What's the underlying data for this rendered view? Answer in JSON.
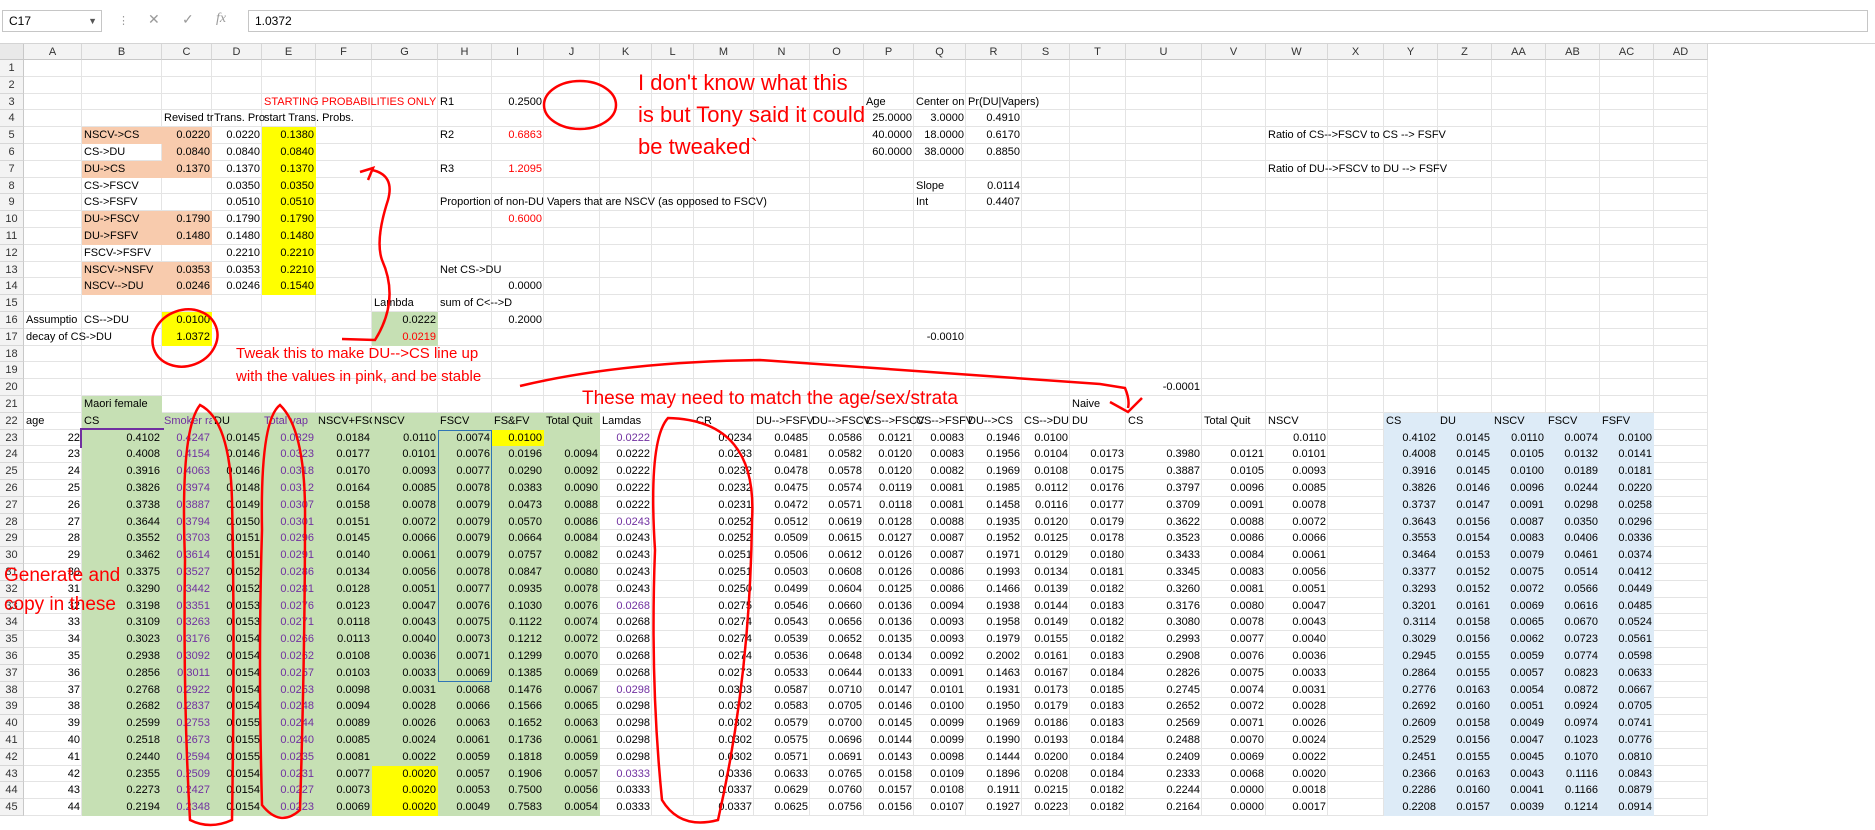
{
  "formula_bar": {
    "name_box": "C17",
    "formula": "1.0372",
    "cancel_icon": "✕",
    "enter_icon": "✓",
    "fx_icon": "fx"
  },
  "columns": [
    "A",
    "B",
    "C",
    "D",
    "E",
    "F",
    "G",
    "H",
    "I",
    "J",
    "K",
    "L",
    "M",
    "N",
    "O",
    "P",
    "Q",
    "R",
    "S",
    "T",
    "U",
    "V",
    "W",
    "X",
    "Y",
    "Z",
    "AA",
    "AB",
    "AC",
    "AD"
  ],
  "rows": [
    "1",
    "2",
    "3",
    "4",
    "5",
    "6",
    "7",
    "8",
    "9",
    "10",
    "11",
    "12",
    "13",
    "14",
    "15",
    "16",
    "17",
    "18",
    "19",
    "20",
    "21",
    "22",
    "23",
    "24",
    "25",
    "26",
    "27",
    "28",
    "29",
    "30",
    "31",
    "32",
    "33",
    "34",
    "35",
    "36",
    "37",
    "38",
    "39",
    "40",
    "41",
    "42",
    "43",
    "44",
    "45"
  ],
  "cells": {
    "E3": "STARTING PROBABILITIES ONLY",
    "H3": "R1",
    "I3": "0.2500",
    "P3": "Age",
    "Q3": "Center on",
    "R3": "Pr(DU|Vapers)",
    "C4": "Revised tr",
    "D4": "Trans. Pro",
    "E4": "start Trans. Probs.",
    "P4": "25.0000",
    "Q4": "3.0000",
    "R4": "0.4910",
    "B5": "NSCV->CS",
    "C5": "0.0220",
    "D5": "0.0220",
    "E5": "0.1380",
    "H5": "R2",
    "I5": "0.6863",
    "P5": "40.0000",
    "Q5": "18.0000",
    "R5": "0.6170",
    "W5": "Ratio of CS-->FSCV to CS --> FSFV",
    "B6": "CS->DU",
    "C6": "0.0840",
    "D6": "0.0840",
    "E6": "0.0840",
    "P6": "60.0000",
    "Q6": "38.0000",
    "R6": "0.8850",
    "B7": "DU->CS",
    "C7": "0.1370",
    "D7": "0.1370",
    "E7": "0.1370",
    "H7": "R3",
    "I7": "1.2095",
    "W7": "Ratio of DU-->FSCV to DU --> FSFV",
    "B8": "CS->FSCV",
    "D8": "0.0350",
    "E8": "0.0350",
    "Q8": "Slope",
    "R8": "0.0114",
    "B9": "CS->FSFV",
    "D9": "0.0510",
    "E9": "0.0510",
    "H9": "Proportion of non-DU Vapers that are NSCV (as opposed to FSCV)",
    "Q9": "Int",
    "R9": "0.4407",
    "B10": "DU->FSCV",
    "C10": "0.1790",
    "D10": "0.1790",
    "E10": "0.1790",
    "I10": "0.6000",
    "B11": "DU->FSFV",
    "C11": "0.1480",
    "D11": "0.1480",
    "E11": "0.1480",
    "B12": "FSCV->FSFV",
    "D12": "0.2210",
    "E12": "0.2210",
    "B13": "NSCV->NSFV",
    "C13": "0.0353",
    "D13": "0.0353",
    "E13": "0.2210",
    "H13": "Net CS->DU",
    "B14": "NSCV-->DU",
    "C14": "0.0246",
    "D14": "0.0246",
    "E14": "0.1540",
    "I14": "0.0000",
    "G15": "Lambda",
    "H15": "sum of C<-->D",
    "A16": "Assumptio",
    "B16": "CS-->DU",
    "C16": "0.0100",
    "G16": "0.0222",
    "I16": "0.2000",
    "A17": "decay of CS->DU",
    "C17": "1.0372",
    "G17": "0.0219",
    "Q17": "-0.0010",
    "U20": "-0.0001",
    "B21": "Maori female",
    "T21": "Naive",
    "A22": "age",
    "B22": "CS",
    "C22": "Smoker ra",
    "D22": "DU",
    "E22": "Total vap",
    "F22": "NSCV+FSCV",
    "G22": "NSCV",
    "H22": "FSCV",
    "I22": "FS&FV",
    "J22": "Total Quit",
    "K22": "Lamdas",
    "M22": "CR",
    "N22": "DU-->FSFV",
    "O22": "DU-->FSCV",
    "P22": "CS-->FSCV",
    "Q22": "CS-->FSFV",
    "R22": "DU-->CS",
    "S22": "CS-->DU",
    "T22": "DU",
    "U22": "CS",
    "V22": "Total Quit",
    "W22": "NSCV",
    "Y22": "CS",
    "Z22": "DU",
    "AA22": "NSCV",
    "AB22": "FSCV",
    "AC22": "FSFV"
  },
  "table": [
    [
      "22",
      "0.4102",
      "0.4247",
      "0.0145",
      "0.0329",
      "0.0184",
      "0.0110",
      "0.0074",
      "0.0100",
      "",
      "0.0222",
      "0.0234",
      "0.0485",
      "0.0586",
      "0.0121",
      "0.0083",
      "0.1946",
      "0.0100",
      "",
      "",
      "",
      "0.0110",
      "0.4102",
      "0.0145",
      "0.0110",
      "0.0074",
      "0.0100"
    ],
    [
      "23",
      "0.4008",
      "0.4154",
      "0.0146",
      "0.0323",
      "0.0177",
      "0.0101",
      "0.0076",
      "0.0196",
      "0.0094",
      "0.0222",
      "0.0233",
      "0.0481",
      "0.0582",
      "0.0120",
      "0.0083",
      "0.1956",
      "0.0104",
      "0.0173",
      "0.3980",
      "0.0121",
      "0.0101",
      "0.4008",
      "0.0145",
      "0.0105",
      "0.0132",
      "0.0141"
    ],
    [
      "24",
      "0.3916",
      "0.4063",
      "0.0146",
      "0.0318",
      "0.0170",
      "0.0093",
      "0.0077",
      "0.0290",
      "0.0092",
      "0.0222",
      "0.0232",
      "0.0478",
      "0.0578",
      "0.0120",
      "0.0082",
      "0.1969",
      "0.0108",
      "0.0175",
      "0.3887",
      "0.0105",
      "0.0093",
      "0.3916",
      "0.0145",
      "0.0100",
      "0.0189",
      "0.0181"
    ],
    [
      "25",
      "0.3826",
      "0.3974",
      "0.0148",
      "0.0312",
      "0.0164",
      "0.0085",
      "0.0078",
      "0.0383",
      "0.0090",
      "0.0222",
      "0.0232",
      "0.0475",
      "0.0574",
      "0.0119",
      "0.0081",
      "0.1985",
      "0.0112",
      "0.0176",
      "0.3797",
      "0.0096",
      "0.0085",
      "0.3826",
      "0.0146",
      "0.0096",
      "0.0244",
      "0.0220"
    ],
    [
      "26",
      "0.3738",
      "0.3887",
      "0.0149",
      "0.0307",
      "0.0158",
      "0.0078",
      "0.0079",
      "0.0473",
      "0.0088",
      "0.0222",
      "0.0231",
      "0.0472",
      "0.0571",
      "0.0118",
      "0.0081",
      "0.1458",
      "0.0116",
      "0.0177",
      "0.3709",
      "0.0091",
      "0.0078",
      "0.3737",
      "0.0147",
      "0.0091",
      "0.0298",
      "0.0258"
    ],
    [
      "27",
      "0.3644",
      "0.3794",
      "0.0150",
      "0.0301",
      "0.0151",
      "0.0072",
      "0.0079",
      "0.0570",
      "0.0086",
      "0.0243",
      "0.0252",
      "0.0512",
      "0.0619",
      "0.0128",
      "0.0088",
      "0.1935",
      "0.0120",
      "0.0179",
      "0.3622",
      "0.0088",
      "0.0072",
      "0.3643",
      "0.0156",
      "0.0087",
      "0.0350",
      "0.0296"
    ],
    [
      "28",
      "0.3552",
      "0.3703",
      "0.0151",
      "0.0296",
      "0.0145",
      "0.0066",
      "0.0079",
      "0.0664",
      "0.0084",
      "0.0243",
      "0.0252",
      "0.0509",
      "0.0615",
      "0.0127",
      "0.0087",
      "0.1952",
      "0.0125",
      "0.0178",
      "0.3523",
      "0.0086",
      "0.0066",
      "0.3553",
      "0.0154",
      "0.0083",
      "0.0406",
      "0.0336"
    ],
    [
      "29",
      "0.3462",
      "0.3614",
      "0.0151",
      "0.0291",
      "0.0140",
      "0.0061",
      "0.0079",
      "0.0757",
      "0.0082",
      "0.0243",
      "0.0251",
      "0.0506",
      "0.0612",
      "0.0126",
      "0.0087",
      "0.1971",
      "0.0129",
      "0.0180",
      "0.3433",
      "0.0084",
      "0.0061",
      "0.3464",
      "0.0153",
      "0.0079",
      "0.0461",
      "0.0374"
    ],
    [
      "30",
      "0.3375",
      "0.3527",
      "0.0152",
      "0.0286",
      "0.0134",
      "0.0056",
      "0.0078",
      "0.0847",
      "0.0080",
      "0.0243",
      "0.0251",
      "0.0503",
      "0.0608",
      "0.0126",
      "0.0086",
      "0.1993",
      "0.0134",
      "0.0181",
      "0.3345",
      "0.0083",
      "0.0056",
      "0.3377",
      "0.0152",
      "0.0075",
      "0.0514",
      "0.0412"
    ],
    [
      "31",
      "0.3290",
      "0.3442",
      "0.0152",
      "0.0281",
      "0.0128",
      "0.0051",
      "0.0077",
      "0.0935",
      "0.0078",
      "0.0243",
      "0.0250",
      "0.0499",
      "0.0604",
      "0.0125",
      "0.0086",
      "0.1466",
      "0.0139",
      "0.0182",
      "0.3260",
      "0.0081",
      "0.0051",
      "0.3293",
      "0.0152",
      "0.0072",
      "0.0566",
      "0.0449"
    ],
    [
      "32",
      "0.3198",
      "0.3351",
      "0.0153",
      "0.0276",
      "0.0123",
      "0.0047",
      "0.0076",
      "0.1030",
      "0.0076",
      "0.0268",
      "0.0275",
      "0.0546",
      "0.0660",
      "0.0136",
      "0.0094",
      "0.1938",
      "0.0144",
      "0.0183",
      "0.3176",
      "0.0080",
      "0.0047",
      "0.3201",
      "0.0161",
      "0.0069",
      "0.0616",
      "0.0485"
    ],
    [
      "33",
      "0.3109",
      "0.3263",
      "0.0153",
      "0.0271",
      "0.0118",
      "0.0043",
      "0.0075",
      "0.1122",
      "0.0074",
      "0.0268",
      "0.0274",
      "0.0543",
      "0.0656",
      "0.0136",
      "0.0093",
      "0.1958",
      "0.0149",
      "0.0182",
      "0.3080",
      "0.0078",
      "0.0043",
      "0.3114",
      "0.0158",
      "0.0065",
      "0.0670",
      "0.0524"
    ],
    [
      "34",
      "0.3023",
      "0.3176",
      "0.0154",
      "0.0266",
      "0.0113",
      "0.0040",
      "0.0073",
      "0.1212",
      "0.0072",
      "0.0268",
      "0.0274",
      "0.0539",
      "0.0652",
      "0.0135",
      "0.0093",
      "0.1979",
      "0.0155",
      "0.0182",
      "0.2993",
      "0.0077",
      "0.0040",
      "0.3029",
      "0.0156",
      "0.0062",
      "0.0723",
      "0.0561"
    ],
    [
      "35",
      "0.2938",
      "0.3092",
      "0.0154",
      "0.0262",
      "0.0108",
      "0.0036",
      "0.0071",
      "0.1299",
      "0.0070",
      "0.0268",
      "0.0274",
      "0.0536",
      "0.0648",
      "0.0134",
      "0.0092",
      "0.2002",
      "0.0161",
      "0.0183",
      "0.2908",
      "0.0076",
      "0.0036",
      "0.2945",
      "0.0155",
      "0.0059",
      "0.0774",
      "0.0598"
    ],
    [
      "36",
      "0.2856",
      "0.3011",
      "0.0154",
      "0.0257",
      "0.0103",
      "0.0033",
      "0.0069",
      "0.1385",
      "0.0069",
      "0.0268",
      "0.0273",
      "0.0533",
      "0.0644",
      "0.0133",
      "0.0091",
      "0.1463",
      "0.0167",
      "0.0184",
      "0.2826",
      "0.0075",
      "0.0033",
      "0.2864",
      "0.0155",
      "0.0057",
      "0.0823",
      "0.0633"
    ],
    [
      "37",
      "0.2768",
      "0.2922",
      "0.0154",
      "0.0253",
      "0.0098",
      "0.0031",
      "0.0068",
      "0.1476",
      "0.0067",
      "0.0298",
      "0.0303",
      "0.0587",
      "0.0710",
      "0.0147",
      "0.0101",
      "0.1931",
      "0.0173",
      "0.0185",
      "0.2745",
      "0.0074",
      "0.0031",
      "0.2776",
      "0.0163",
      "0.0054",
      "0.0872",
      "0.0667"
    ],
    [
      "38",
      "0.2682",
      "0.2837",
      "0.0154",
      "0.0248",
      "0.0094",
      "0.0028",
      "0.0066",
      "0.1566",
      "0.0065",
      "0.0298",
      "0.0302",
      "0.0583",
      "0.0705",
      "0.0146",
      "0.0100",
      "0.1950",
      "0.0179",
      "0.0183",
      "0.2652",
      "0.0072",
      "0.0028",
      "0.2692",
      "0.0160",
      "0.0051",
      "0.0924",
      "0.0705"
    ],
    [
      "39",
      "0.2599",
      "0.2753",
      "0.0155",
      "0.0244",
      "0.0089",
      "0.0026",
      "0.0063",
      "0.1652",
      "0.0063",
      "0.0298",
      "0.0302",
      "0.0579",
      "0.0700",
      "0.0145",
      "0.0099",
      "0.1969",
      "0.0186",
      "0.0183",
      "0.2569",
      "0.0071",
      "0.0026",
      "0.2609",
      "0.0158",
      "0.0049",
      "0.0974",
      "0.0741"
    ],
    [
      "40",
      "0.2518",
      "0.2673",
      "0.0155",
      "0.0240",
      "0.0085",
      "0.0024",
      "0.0061",
      "0.1736",
      "0.0061",
      "0.0298",
      "0.0302",
      "0.0575",
      "0.0696",
      "0.0144",
      "0.0099",
      "0.1990",
      "0.0193",
      "0.0184",
      "0.2488",
      "0.0070",
      "0.0024",
      "0.2529",
      "0.0156",
      "0.0047",
      "0.1023",
      "0.0776"
    ],
    [
      "41",
      "0.2440",
      "0.2594",
      "0.0155",
      "0.0235",
      "0.0081",
      "0.0022",
      "0.0059",
      "0.1818",
      "0.0059",
      "0.0298",
      "0.0302",
      "0.0571",
      "0.0691",
      "0.0143",
      "0.0098",
      "0.1444",
      "0.0200",
      "0.0184",
      "0.2409",
      "0.0069",
      "0.0022",
      "0.2451",
      "0.0155",
      "0.0045",
      "0.1070",
      "0.0810"
    ],
    [
      "42",
      "0.2355",
      "0.2509",
      "0.0154",
      "0.0231",
      "0.0077",
      "0.0020",
      "0.0057",
      "0.1906",
      "0.0057",
      "0.0333",
      "0.0336",
      "0.0633",
      "0.0765",
      "0.0158",
      "0.0109",
      "0.1896",
      "0.0208",
      "0.0184",
      "0.2333",
      "0.0068",
      "0.0020",
      "0.2366",
      "0.0163",
      "0.0043",
      "0.1116",
      "0.0843"
    ],
    [
      "43",
      "0.2273",
      "0.2427",
      "0.0154",
      "0.0227",
      "0.0073",
      "0.0020",
      "0.0053",
      "0.7500",
      "0.0056",
      "0.0333",
      "0.0337",
      "0.0629",
      "0.0760",
      "0.0157",
      "0.0108",
      "0.1911",
      "0.0215",
      "0.0182",
      "0.2244",
      "0.0000",
      "0.0018",
      "0.2286",
      "0.0160",
      "0.0041",
      "0.1166",
      "0.0879"
    ],
    [
      "44",
      "0.2194",
      "0.2348",
      "0.0154",
      "0.0223",
      "0.0069",
      "0.0020",
      "0.0049",
      "0.7583",
      "0.0054",
      "0.0333",
      "0.0337",
      "0.0625",
      "0.0756",
      "0.0156",
      "0.0107",
      "0.1927",
      "0.0223",
      "0.0182",
      "0.2164",
      "0.0000",
      "0.0017",
      "0.2208",
      "0.0157",
      "0.0039",
      "0.1214",
      "0.0914"
    ]
  ],
  "annotations": {
    "a1": "I don't know what this",
    "a2": "is but Tony said it could",
    "a3": "be tweaked`",
    "a4": "Tweak this to make DU-->CS line up",
    "a5": "with the values in pink, and be stable",
    "a6": "These may need to match the age/sex/strata",
    "a7": "Generate and",
    "a8": "copy in these"
  },
  "colors": {
    "green_fill": "#c6e0b4",
    "yellow_fill": "#ffff00",
    "pink_fill": "#f8cbad",
    "blue_fill": "#ddebf7",
    "annotation_red": "#ff0000",
    "purple_text": "#7030a0"
  }
}
